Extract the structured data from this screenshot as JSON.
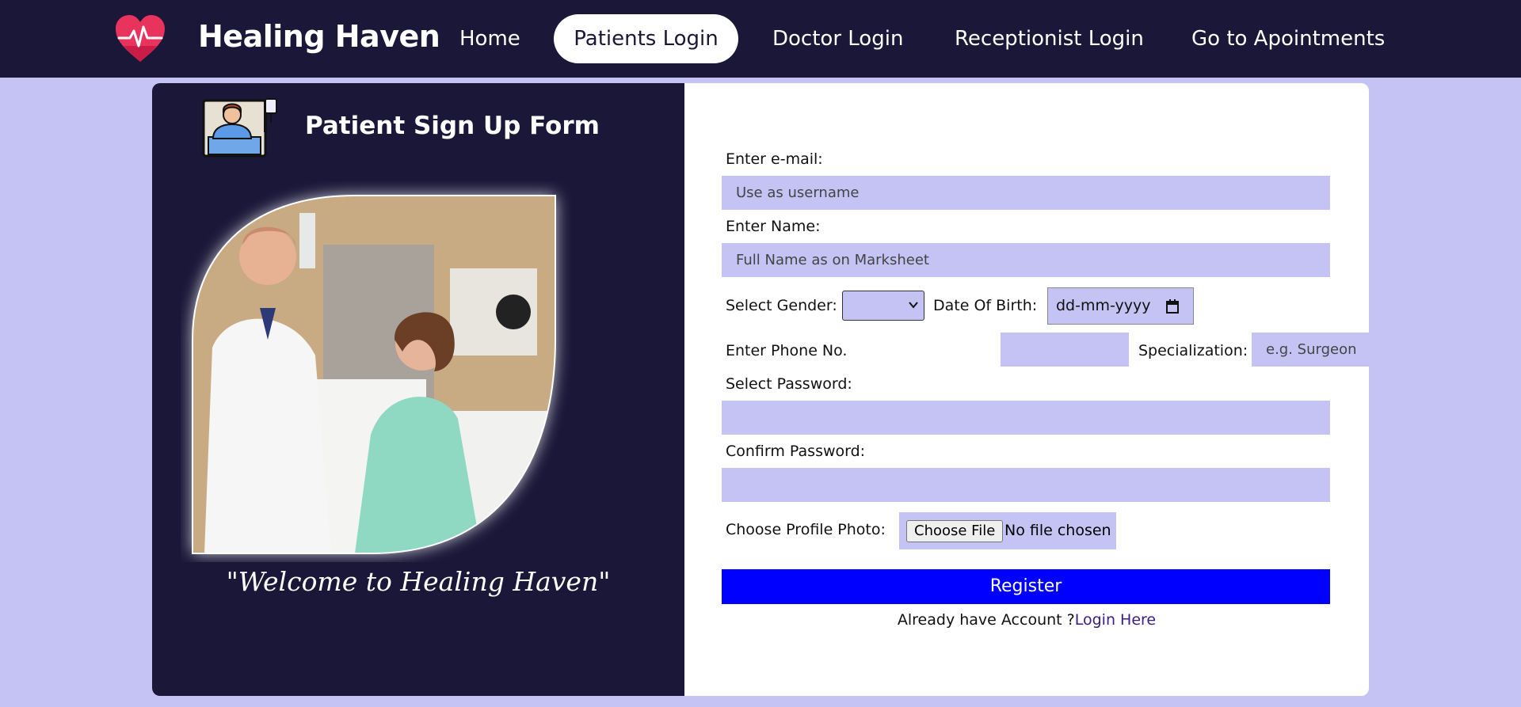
{
  "navbar": {
    "brand": "Healing Haven",
    "items": [
      {
        "label": "Home",
        "active": false
      },
      {
        "label": "Patients Login",
        "active": true
      },
      {
        "label": "Doctor Login",
        "active": false
      },
      {
        "label": "Receptionist Login",
        "active": false
      },
      {
        "label": "Go to Apointments",
        "active": false
      }
    ]
  },
  "left_panel": {
    "title": "Patient Sign Up Form",
    "icon": "patient-in-bed-icon",
    "welcome": "\"Welcome to Healing Haven\""
  },
  "form": {
    "email_label": "Enter e-mail:",
    "email_placeholder": "Use as username",
    "name_label": "Enter Name:",
    "name_placeholder": "Full Name as on Marksheet",
    "gender_label": "Select Gender:",
    "gender_value": "",
    "dob_label": "Date Of Birth:",
    "dob_value": "dd-mm-yyyy",
    "phone_label": "Enter Phone No.",
    "phone_value": "",
    "specialization_label": "Specialization:",
    "specialization_placeholder": "e.g. Surgeon",
    "password_label": "Select Password:",
    "confirm_label": "Confirm Password:",
    "photo_label": "Choose Profile Photo:",
    "photo_button": "Choose File",
    "photo_status": "No file chosen",
    "register_label": "Register",
    "already_text": "Already have Account ?",
    "login_link": "Login Here"
  },
  "colors": {
    "nav_bg": "#1a1738",
    "page_bg": "#c4c3f4",
    "field_bg": "#c4c3f4",
    "register_bg": "#0000ff",
    "heart": "#e8335d"
  }
}
